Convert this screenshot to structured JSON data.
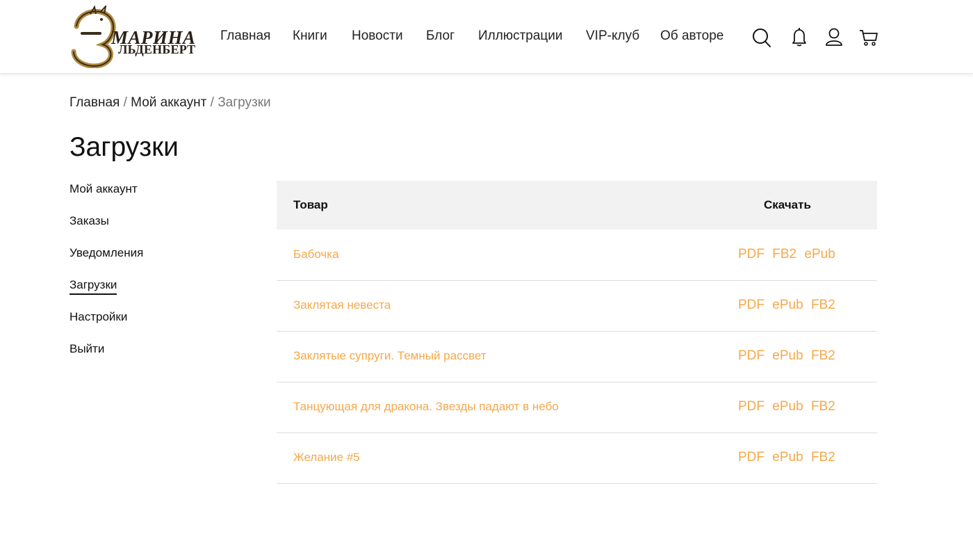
{
  "header": {
    "logo": {
      "line1": "МАРИНА",
      "line2": "ЛЬДЕНБЕРТ",
      "mark": "Э"
    },
    "nav": [
      "Главная",
      "Книги",
      "Новости",
      "Блог",
      "Иллюстрации",
      "VIP-клуб",
      "Об авторе"
    ],
    "icons": [
      "search-icon",
      "bell-icon",
      "user-icon",
      "cart-icon"
    ]
  },
  "breadcrumb": {
    "home": "Главная",
    "sep1": "/",
    "account": "Мой аккаунт",
    "sep2": "/",
    "current": "Загрузки"
  },
  "page": {
    "title": "Загрузки"
  },
  "sidebar": {
    "items": [
      "Мой аккаунт",
      "Заказы",
      "Уведомления",
      "Загрузки",
      "Настройки",
      "Выйти"
    ],
    "active": "Загрузки"
  },
  "downloads": {
    "headers": {
      "product": "Товар",
      "download": "Скачать"
    },
    "rows": [
      {
        "title": "Бабочка",
        "formats": [
          "PDF",
          "FB2",
          "ePub"
        ]
      },
      {
        "title": "Заклятая невеста",
        "formats": [
          "PDF",
          "ePub",
          "FB2"
        ]
      },
      {
        "title": "Заклятые супруги. Темный рассвет",
        "formats": [
          "PDF",
          "ePub",
          "FB2"
        ]
      },
      {
        "title": "Танцующая для дракона. Звезды падают в небо",
        "formats": [
          "PDF",
          "ePub",
          "FB2"
        ]
      },
      {
        "title": "Желание #5",
        "formats": [
          "PDF",
          "ePub",
          "FB2"
        ]
      }
    ]
  },
  "colors": {
    "accent": "#f5a84a",
    "header_bg": "#f2f2f2",
    "text": "#111111",
    "muted": "#777777",
    "logo_gold": "#b08a3e"
  }
}
